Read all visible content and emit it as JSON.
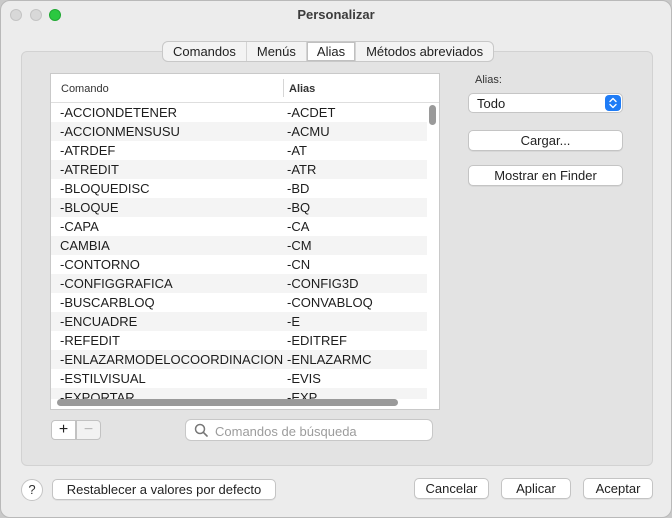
{
  "window": {
    "title": "Personalizar"
  },
  "tabs": [
    {
      "label": "Comandos",
      "selected": false
    },
    {
      "label": "Menús",
      "selected": false
    },
    {
      "label": "Alias",
      "selected": true
    },
    {
      "label": "Métodos abreviados",
      "selected": false
    }
  ],
  "table": {
    "headers": {
      "command": "Comando",
      "alias": "Alias"
    },
    "rows": [
      {
        "command": "-ACCIONDETENER",
        "alias": "-ACDET"
      },
      {
        "command": "-ACCIONMENSUSU",
        "alias": "-ACMU"
      },
      {
        "command": "-ATRDEF",
        "alias": "-AT"
      },
      {
        "command": "-ATREDIT",
        "alias": "-ATR"
      },
      {
        "command": "-BLOQUEDISC",
        "alias": "-BD"
      },
      {
        "command": "-BLOQUE",
        "alias": "-BQ"
      },
      {
        "command": "-CAPA",
        "alias": "-CA"
      },
      {
        "command": "CAMBIA",
        "alias": "-CM"
      },
      {
        "command": "-CONTORNO",
        "alias": "-CN"
      },
      {
        "command": "-CONFIGGRAFICA",
        "alias": "-CONFIG3D"
      },
      {
        "command": "-BUSCARBLOQ",
        "alias": "-CONVABLOQ"
      },
      {
        "command": "-ENCUADRE",
        "alias": "-E"
      },
      {
        "command": "-REFEDIT",
        "alias": "-EDITREF"
      },
      {
        "command": "-ENLAZARMODELOCOORDINACION",
        "alias": "-ENLAZARMC"
      },
      {
        "command": "-ESTILVISUAL",
        "alias": "-EVIS"
      },
      {
        "command": "-EXPORTAR",
        "alias": "-EXP"
      }
    ],
    "add_label": "+",
    "remove_label": "−"
  },
  "search": {
    "placeholder": "Comandos de búsqueda",
    "value": ""
  },
  "alias_filter": {
    "label": "Alias:",
    "selected": "Todo"
  },
  "buttons": {
    "load": "Cargar...",
    "show_in_finder": "Mostrar en Finder",
    "help": "?",
    "reset": "Restablecer a valores por defecto",
    "cancel": "Cancelar",
    "apply": "Aplicar",
    "ok": "Aceptar"
  },
  "colors": {
    "accent": "#1f7cf6",
    "zoom_button": "#2bc840"
  }
}
